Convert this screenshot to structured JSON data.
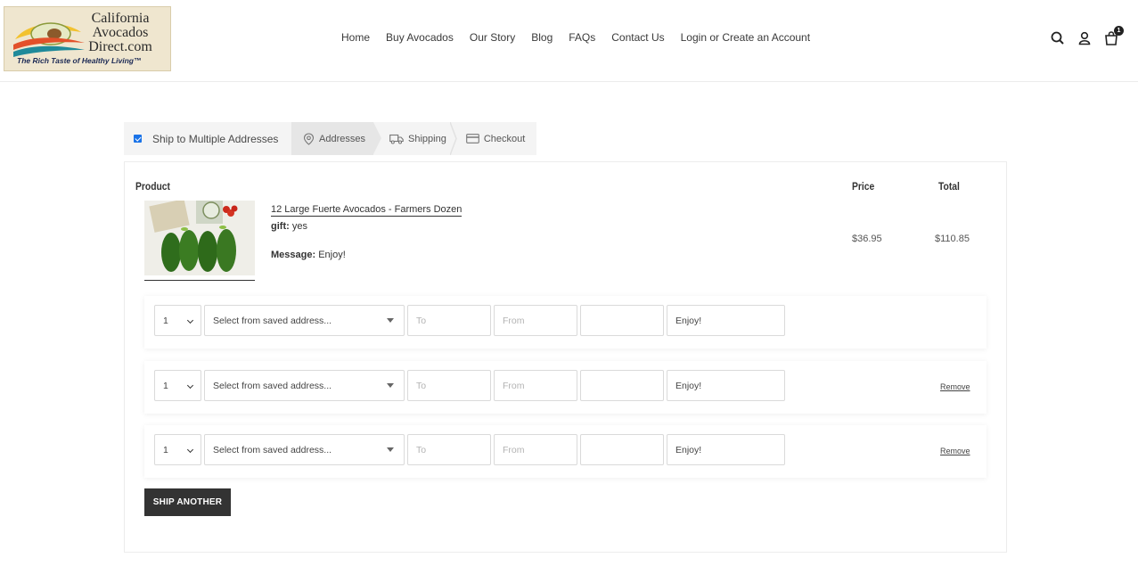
{
  "header": {
    "logo": {
      "line1": "California",
      "line2": "Avocados",
      "line3": "Direct.com",
      "tagline": "The Rich Taste of Healthy Living™"
    },
    "nav": [
      {
        "label": "Home"
      },
      {
        "label": "Buy Avocados"
      },
      {
        "label": "Our Story"
      },
      {
        "label": "Blog"
      },
      {
        "label": "FAQs"
      },
      {
        "label": "Contact Us"
      },
      {
        "label": "Login or Create an Account"
      }
    ],
    "icons": [
      "search-icon",
      "account-icon",
      "cart-icon"
    ],
    "cart_count": "1"
  },
  "steps": {
    "ship_multiple_label": "Ship to Multiple Addresses",
    "ship_multiple_checked": true,
    "items": [
      {
        "label": "Addresses",
        "icon": "location-pin-icon",
        "active": true
      },
      {
        "label": "Shipping",
        "icon": "truck-icon",
        "active": false
      },
      {
        "label": "Checkout",
        "icon": "credit-card-icon",
        "active": false
      }
    ]
  },
  "table": {
    "headers": {
      "product": "Product",
      "price": "Price",
      "total": "Total"
    },
    "product": {
      "title": "12 Large Fuerte Avocados - Farmers Dozen",
      "gift_label": "gift:",
      "gift_value": "yes",
      "message_label": "Message:",
      "message_value": "Enjoy!",
      "price": "$36.95",
      "total": "$110.85"
    },
    "shipments": [
      {
        "qty": "1",
        "address_placeholder": "Select from saved address...",
        "to_placeholder": "To",
        "from_placeholder": "From",
        "extra": "",
        "message": "Enjoy!",
        "remove": ""
      },
      {
        "qty": "1",
        "address_placeholder": "Select from saved address...",
        "to_placeholder": "To",
        "from_placeholder": "From",
        "extra": "",
        "message": "Enjoy!",
        "remove": "Remove"
      },
      {
        "qty": "1",
        "address_placeholder": "Select from saved address...",
        "to_placeholder": "To",
        "from_placeholder": "From",
        "extra": "",
        "message": "Enjoy!",
        "remove": "Remove"
      }
    ],
    "ship_another_label": "SHIP ANOTHER"
  },
  "colors": {
    "accent_checkbox": "#1a73e8",
    "button_dark": "#333333",
    "step_active_bg": "#e6e6e6",
    "step_bar_bg": "#f4f4f4"
  }
}
